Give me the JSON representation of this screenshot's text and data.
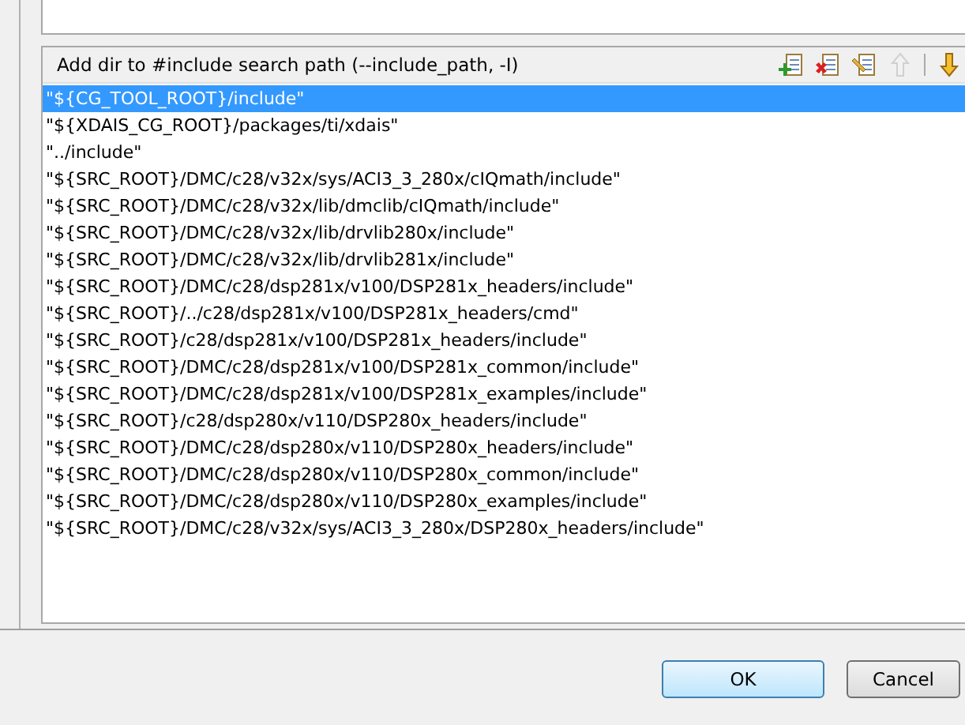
{
  "panel": {
    "title": "Add dir to #include search path (--include_path, -I)",
    "toolbar": [
      {
        "kind": "add",
        "disabled": false
      },
      {
        "kind": "delete",
        "disabled": false
      },
      {
        "kind": "edit",
        "disabled": false
      },
      {
        "kind": "up",
        "disabled": true
      },
      {
        "kind": "down",
        "disabled": false
      }
    ],
    "items": [
      {
        "text": "\"${CG_TOOL_ROOT}/include\"",
        "selected": true
      },
      {
        "text": "\"${XDAIS_CG_ROOT}/packages/ti/xdais\"",
        "selected": false
      },
      {
        "text": "\"../include\"",
        "selected": false
      },
      {
        "text": "\"${SRC_ROOT}/DMC/c28/v32x/sys/ACI3_3_280x/cIQmath/include\"",
        "selected": false
      },
      {
        "text": "\"${SRC_ROOT}/DMC/c28/v32x/lib/dmclib/cIQmath/include\"",
        "selected": false
      },
      {
        "text": "\"${SRC_ROOT}/DMC/c28/v32x/lib/drvlib280x/include\"",
        "selected": false
      },
      {
        "text": "\"${SRC_ROOT}/DMC/c28/v32x/lib/drvlib281x/include\"",
        "selected": false
      },
      {
        "text": "\"${SRC_ROOT}/DMC/c28/dsp281x/v100/DSP281x_headers/include\"",
        "selected": false
      },
      {
        "text": "\"${SRC_ROOT}/../c28/dsp281x/v100/DSP281x_headers/cmd\"",
        "selected": false
      },
      {
        "text": "\"${SRC_ROOT}/c28/dsp281x/v100/DSP281x_headers/include\"",
        "selected": false
      },
      {
        "text": "\"${SRC_ROOT}/DMC/c28/dsp281x/v100/DSP281x_common/include\"",
        "selected": false
      },
      {
        "text": "\"${SRC_ROOT}/DMC/c28/dsp281x/v100/DSP281x_examples/include\"",
        "selected": false
      },
      {
        "text": "\"${SRC_ROOT}/c28/dsp280x/v110/DSP280x_headers/include\"",
        "selected": false
      },
      {
        "text": "\"${SRC_ROOT}/DMC/c28/dsp280x/v110/DSP280x_headers/include\"",
        "selected": false
      },
      {
        "text": "\"${SRC_ROOT}/DMC/c28/dsp280x/v110/DSP280x_common/include\"",
        "selected": false
      },
      {
        "text": "\"${SRC_ROOT}/DMC/c28/dsp280x/v110/DSP280x_examples/include\"",
        "selected": false
      },
      {
        "text": "\"${SRC_ROOT}/DMC/c28/v32x/sys/ACI3_3_280x/DSP280x_headers/include\"",
        "selected": false
      }
    ]
  },
  "buttons": [
    {
      "label": "OK",
      "kind": "default"
    },
    {
      "label": "Cancel",
      "kind": "normal"
    }
  ]
}
